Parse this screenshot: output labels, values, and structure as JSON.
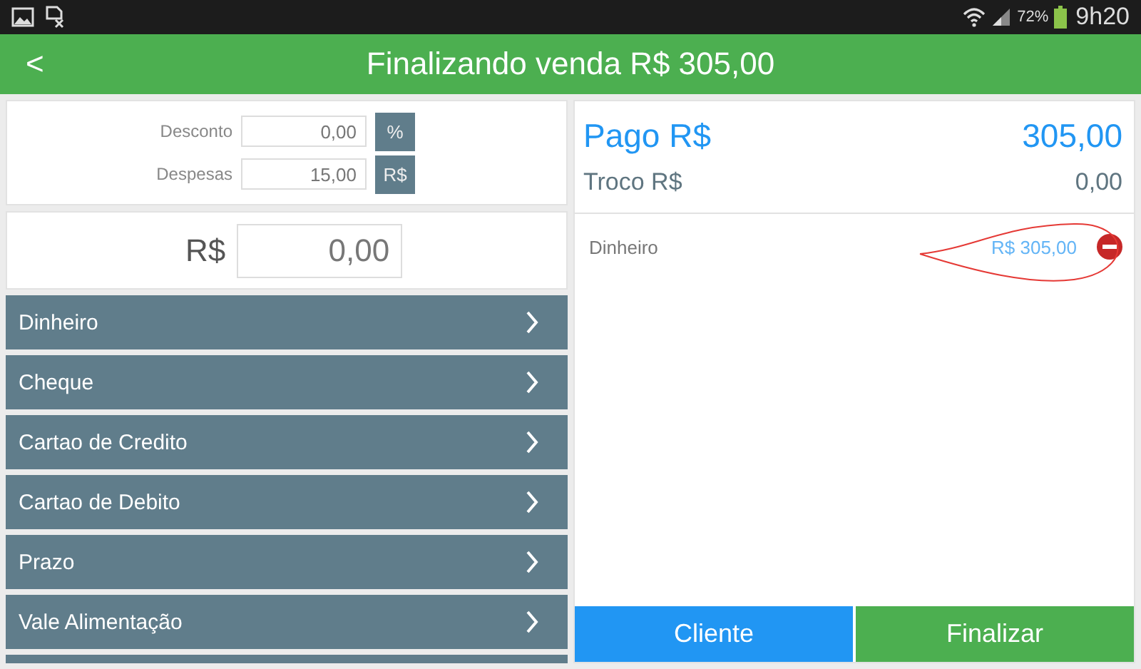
{
  "status_bar": {
    "battery_text": "72%",
    "time": "9h20"
  },
  "header": {
    "back": "<",
    "title": "Finalizando venda R$ 305,00"
  },
  "adjustments": [
    {
      "label": "Desconto",
      "value": "0,00",
      "unit": "%"
    },
    {
      "label": "Despesas",
      "value": "15,00",
      "unit": "R$"
    }
  ],
  "amount": {
    "label": "R$",
    "placeholder": "0,00"
  },
  "payment_methods": [
    {
      "label": "Dinheiro"
    },
    {
      "label": "Cheque"
    },
    {
      "label": "Cartao de Credito"
    },
    {
      "label": "Cartao de Debito"
    },
    {
      "label": "Prazo"
    },
    {
      "label": "Vale Alimentação"
    }
  ],
  "summary": {
    "paid_label": "Pago R$",
    "paid_value": "305,00",
    "change_label": "Troco R$",
    "change_value": "0,00"
  },
  "payments": [
    {
      "method": "Dinheiro",
      "amount": "R$ 305,00"
    }
  ],
  "buttons": [
    {
      "label": "Cliente",
      "kind": "secondary"
    },
    {
      "label": "Finalizar",
      "kind": "primary"
    }
  ]
}
